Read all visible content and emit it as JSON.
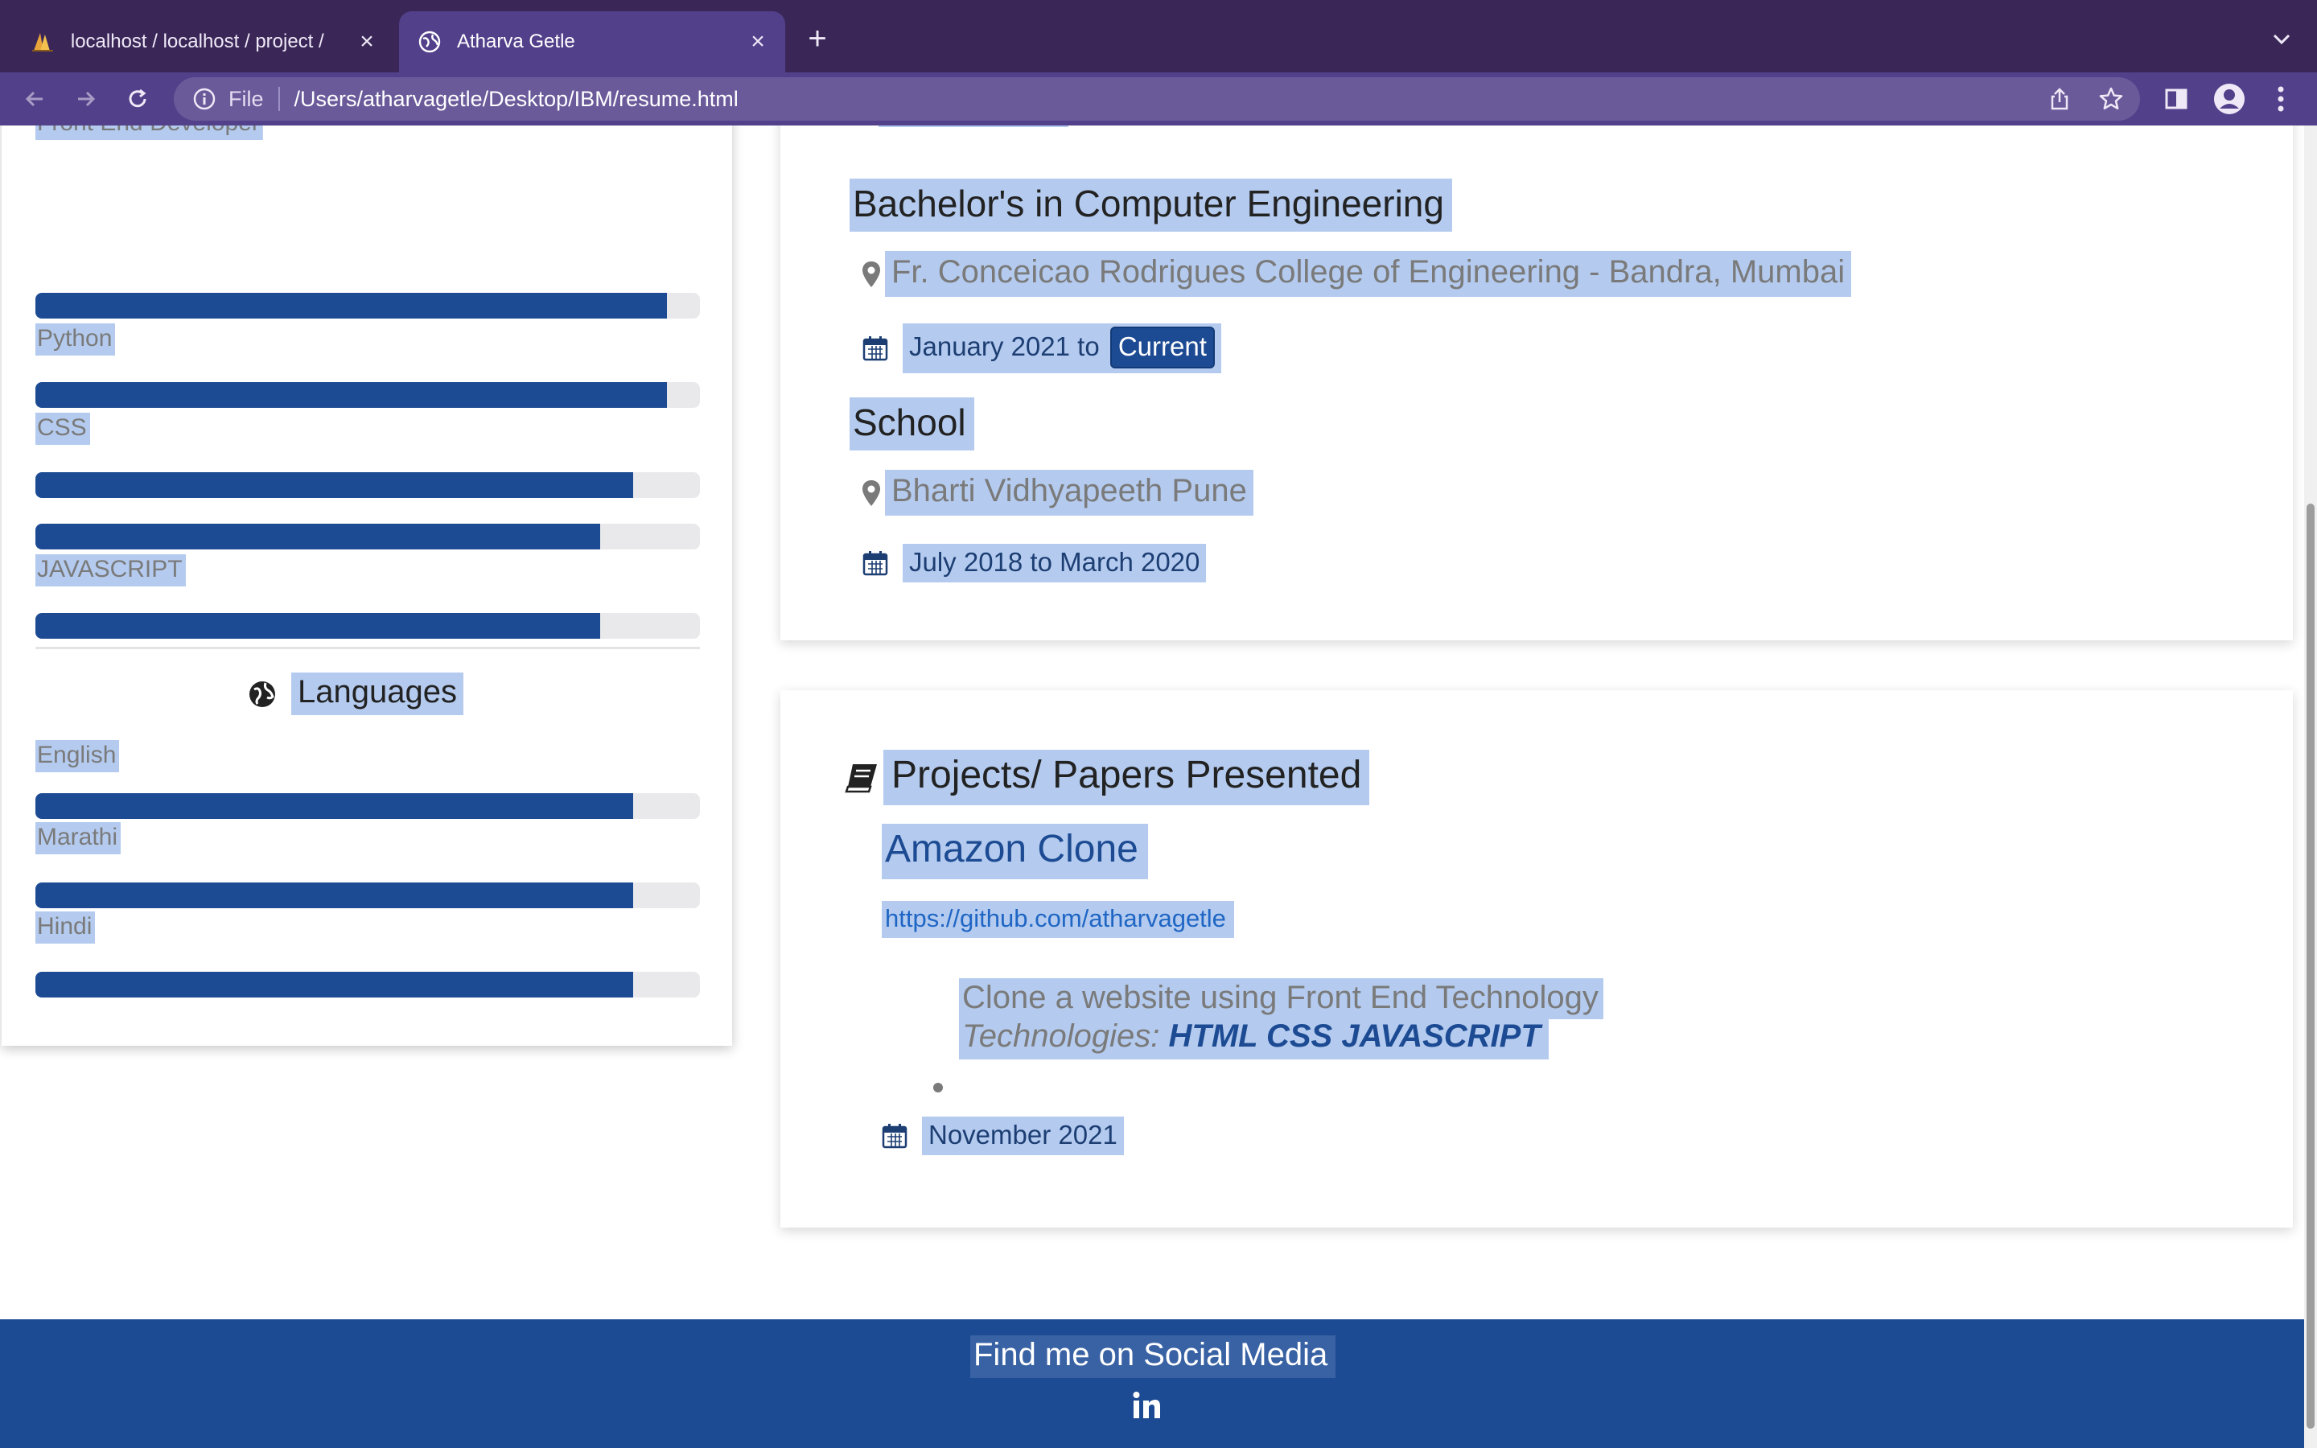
{
  "browser": {
    "tabs": [
      {
        "title": "localhost / localhost / project / ",
        "active": false
      },
      {
        "title": "Atharva Getle",
        "active": true
      }
    ],
    "url_scheme": "File",
    "url": "/Users/atharvagetle/Desktop/IBM/resume.html"
  },
  "skills": {
    "partial_label": "Front End Developer",
    "items": [
      {
        "label": "Python",
        "level": 0.95
      },
      {
        "label": "CSS",
        "level": 0.95
      },
      {
        "label": "",
        "level": 0.9
      },
      {
        "label": "JAVASCRIPT",
        "level": 0.85
      },
      {
        "label": "",
        "level": 0.85
      }
    ]
  },
  "languages": {
    "heading": "Languages",
    "items": [
      {
        "label": "English",
        "level": 0.9
      },
      {
        "label": "Marathi",
        "level": 0.9
      },
      {
        "label": "Hindi",
        "level": 0.9
      }
    ]
  },
  "education": [
    {
      "title": "Bachelor's in Computer Engineering",
      "location": "Fr. Conceicao Rodrigues College of Engineering - Bandra, Mumbai",
      "date": "January 2021 to",
      "badge": "Current"
    },
    {
      "title": "School",
      "location": "Bharti Vidhyapeeth Pune",
      "date": "July 2018 to March 2020"
    }
  ],
  "projects": {
    "heading": "Projects/ Papers Presented",
    "items": [
      {
        "name": "Amazon Clone",
        "link": "https://github.com/atharvagetle",
        "description": "Clone a website using Front End Technology",
        "tech_label": "Technologies:",
        "tech_values": "HTML CSS JAVASCRIPT",
        "date": "November 2021"
      }
    ]
  },
  "footer": {
    "title": "Find me on Social Media",
    "social_icon": "linkedin-icon"
  },
  "colors": {
    "chrome": "#3a2758",
    "toolbar": "#52408a",
    "accent": "#1d4b93",
    "selection": "#b4cbef"
  }
}
